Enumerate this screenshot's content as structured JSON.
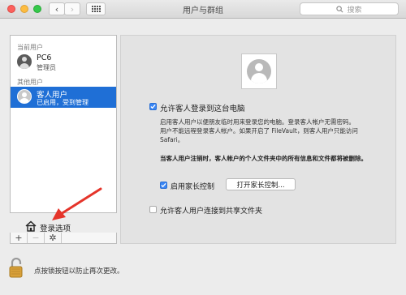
{
  "window": {
    "title": "用户与群组"
  },
  "search": {
    "placeholder": "搜索"
  },
  "sidebar": {
    "current_users_label": "当前用户",
    "current_user": {
      "name": "PC6",
      "role": "管理员"
    },
    "other_users_label": "其他用户",
    "guest_user": {
      "name": "客人用户",
      "status": "已启用，受到管理"
    },
    "login_options_label": "登录选项",
    "tools": {
      "add": "+",
      "remove": "−",
      "gear": "✲"
    }
  },
  "panel": {
    "allow_guest_login": {
      "label": "允许客人登录到这台电脑",
      "checked": true
    },
    "description_line1": "启用客人用户以便朋友临时用来登录您的电脑。登录客人帐户无需密码。",
    "description_line2": "用户不能远程登录客人帐户。如果开启了 FileVault，则客人用户只能访问",
    "description_line3": "Safari。",
    "warning": "当客人用户注销时，客人帐户的个人文件夹中的所有信息和文件都将被删除。",
    "parental_controls": {
      "label": "启用家长控制",
      "checked": true
    },
    "open_parental_button": "打开家长控制...",
    "allow_shared_folders": {
      "label": "允许客人用户连接到共享文件夹",
      "checked": false
    }
  },
  "footer": {
    "lock_text": "点按锁按钮以防止再次更改。"
  },
  "colors": {
    "selection": "#1f6fd6",
    "checkbox": "#3a86f4",
    "arrow": "#e5342a"
  }
}
